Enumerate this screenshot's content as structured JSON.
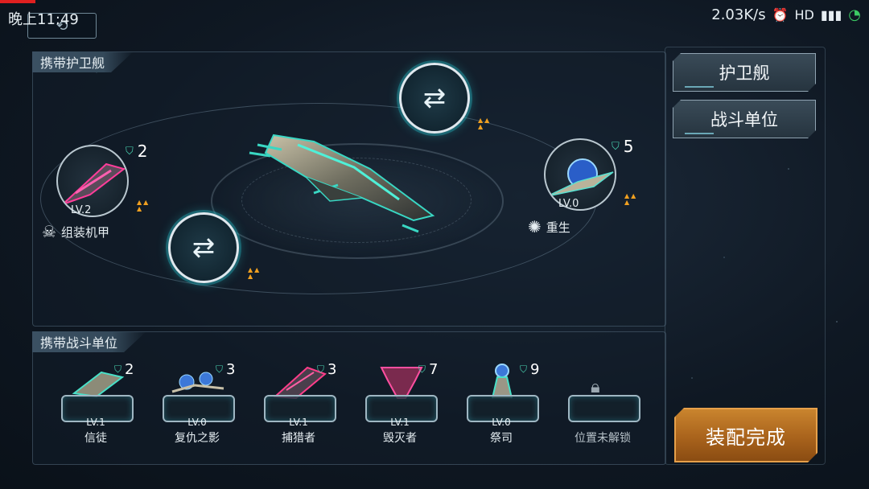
{
  "status_bar": {
    "time": "晚上11:49",
    "network_speed": "2.03K/s",
    "icons": [
      "alarm-icon",
      "hd-icon",
      "signal-icon",
      "wifi-icon"
    ],
    "back_glyph": "⟲"
  },
  "escort_panel": {
    "title": "携带护卫舰",
    "swap_glyph": "⇄",
    "left_escort": {
      "level": "LV.2",
      "count": "2",
      "skill": "组装机甲"
    },
    "right_escort": {
      "level": "LV.0",
      "count": "5",
      "skill": "重生"
    }
  },
  "combat_panel": {
    "title": "携带战斗单位",
    "slots": [
      {
        "level": "LV.1",
        "name": "信徒",
        "count": "2"
      },
      {
        "level": "LV.0",
        "name": "复仇之影",
        "count": "3"
      },
      {
        "level": "LV.1",
        "name": "捕猎者",
        "count": "3"
      },
      {
        "level": "LV.1",
        "name": "毁灭者",
        "count": "7"
      },
      {
        "level": "LV.0",
        "name": "祭司",
        "count": "9"
      },
      {
        "name": "位置未解锁"
      }
    ]
  },
  "side": {
    "tab_escort": "护卫舰",
    "tab_combat": "战斗单位",
    "done": "装配完成"
  },
  "colors": {
    "accent": "#2ec9c9",
    "done": "#b8732a",
    "warning": "#f0a020"
  }
}
